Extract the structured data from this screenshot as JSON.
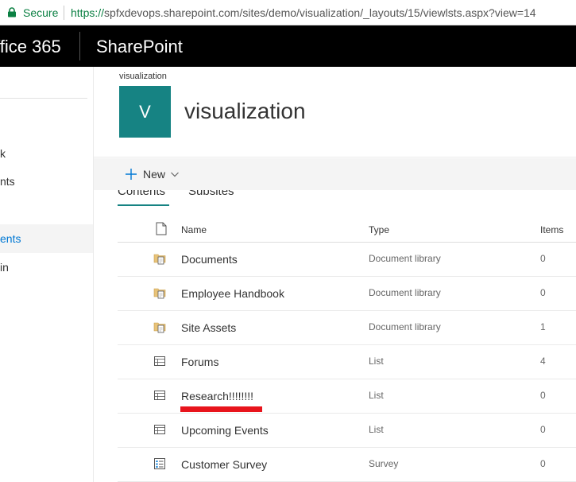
{
  "browser": {
    "secure_label": "Secure",
    "url_scheme": "https://",
    "url_rest": "spfxdevops.sharepoint.com/sites/demo/visualization/_layouts/15/viewlsts.aspx?view=14"
  },
  "suite": {
    "app_launcher_text": "ffice 365",
    "product": "SharePoint"
  },
  "leftnav": {
    "items": [
      {
        "label": "k"
      },
      {
        "label": "nts"
      },
      {
        "label": "ents"
      },
      {
        "label": "in"
      }
    ]
  },
  "site": {
    "breadcrumb": "visualization",
    "logo_letter": "V",
    "title": "visualization",
    "logo_color": "#168383"
  },
  "command_bar": {
    "new_label": "New"
  },
  "tabs": [
    {
      "label": "Contents"
    },
    {
      "label": "Subsites"
    }
  ],
  "table": {
    "headers": {
      "name": "Name",
      "type": "Type",
      "items": "Items"
    },
    "rows": [
      {
        "icon": "document-library-icon",
        "name": "Documents",
        "type": "Document library",
        "items": "0"
      },
      {
        "icon": "document-library-icon",
        "name": "Employee Handbook",
        "type": "Document library",
        "items": "0"
      },
      {
        "icon": "document-library-icon",
        "name": "Site Assets",
        "type": "Document library",
        "items": "1"
      },
      {
        "icon": "list-icon",
        "name": "Forums",
        "type": "List",
        "items": "4"
      },
      {
        "icon": "list-icon",
        "name": "Research!!!!!!!!",
        "type": "List",
        "items": "0"
      },
      {
        "icon": "list-icon",
        "name": "Upcoming Events",
        "type": "List",
        "items": "0"
      },
      {
        "icon": "survey-icon",
        "name": "Customer Survey",
        "type": "Survey",
        "items": "0"
      }
    ]
  },
  "annotation_color": "#e8141c"
}
